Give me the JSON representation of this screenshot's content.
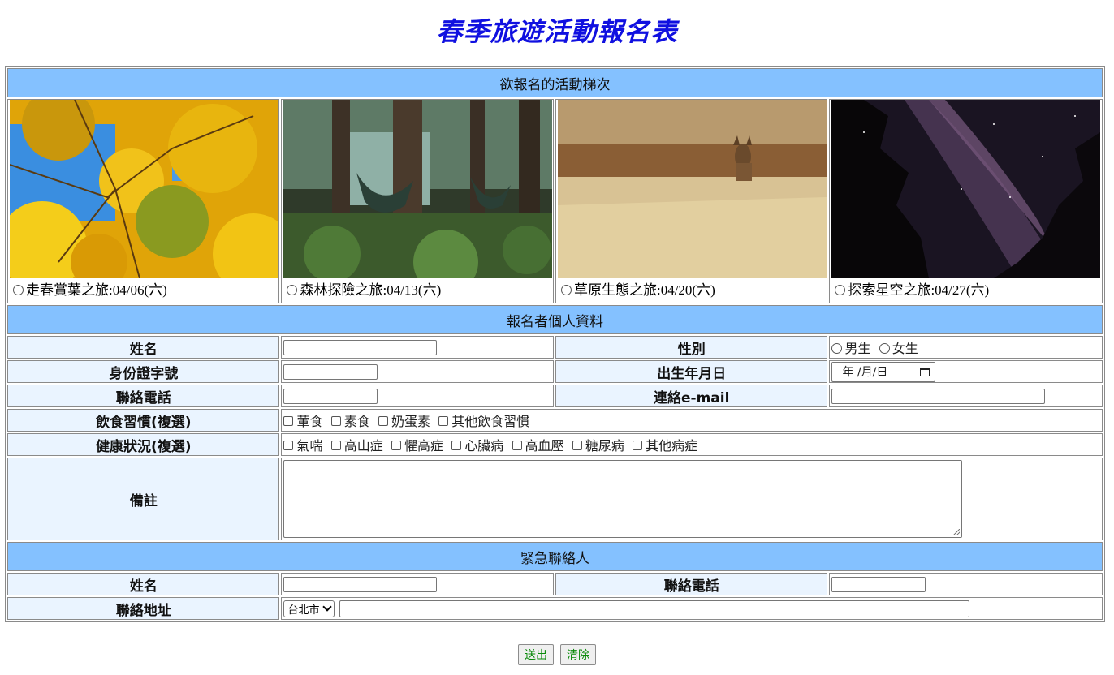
{
  "page": {
    "title": "春季旅遊活動報名表"
  },
  "sections": {
    "activities": "欲報名的活動梯次",
    "personal": "報名者個人資料",
    "emergency": "緊急聯絡人"
  },
  "activities": [
    {
      "label": "走春賞葉之旅:04/06(六)",
      "image": "autumn-leaves-photo"
    },
    {
      "label": "森林探險之旅:04/13(六)",
      "image": "forest-camp-photo"
    },
    {
      "label": "草原生態之旅:04/20(六)",
      "image": "grassland-fox-photo"
    },
    {
      "label": "探索星空之旅:04/27(六)",
      "image": "milky-way-photo"
    }
  ],
  "personal": {
    "name_label": "姓名",
    "gender_label": "性別",
    "gender_options": [
      "男生",
      "女生"
    ],
    "id_label": "身份證字號",
    "birthday_label": "出生年月日",
    "birthday_placeholder": "年 /月/日",
    "phone_label": "聯絡電話",
    "email_label": "連絡e-mail",
    "diet_label": "飲食習慣(複選)",
    "diet_options": [
      "葷食",
      "素食",
      "奶蛋素",
      "其他飲食習慣"
    ],
    "health_label": "健康狀況(複選)",
    "health_options": [
      "氣喘",
      "高山症",
      "懼高症",
      "心臟病",
      "高血壓",
      "糖尿病",
      "其他病症"
    ],
    "notes_label": "備註"
  },
  "emergency": {
    "name_label": "姓名",
    "phone_label": "聯絡電話",
    "address_label": "聯絡地址",
    "city_selected": "台北市"
  },
  "buttons": {
    "submit": "送出",
    "reset": "清除"
  },
  "colors": {
    "section_bg": "#84c1ff",
    "label_bg": "#eaf4ff",
    "title": "#1010e0",
    "button_text": "#0a8a0a"
  }
}
